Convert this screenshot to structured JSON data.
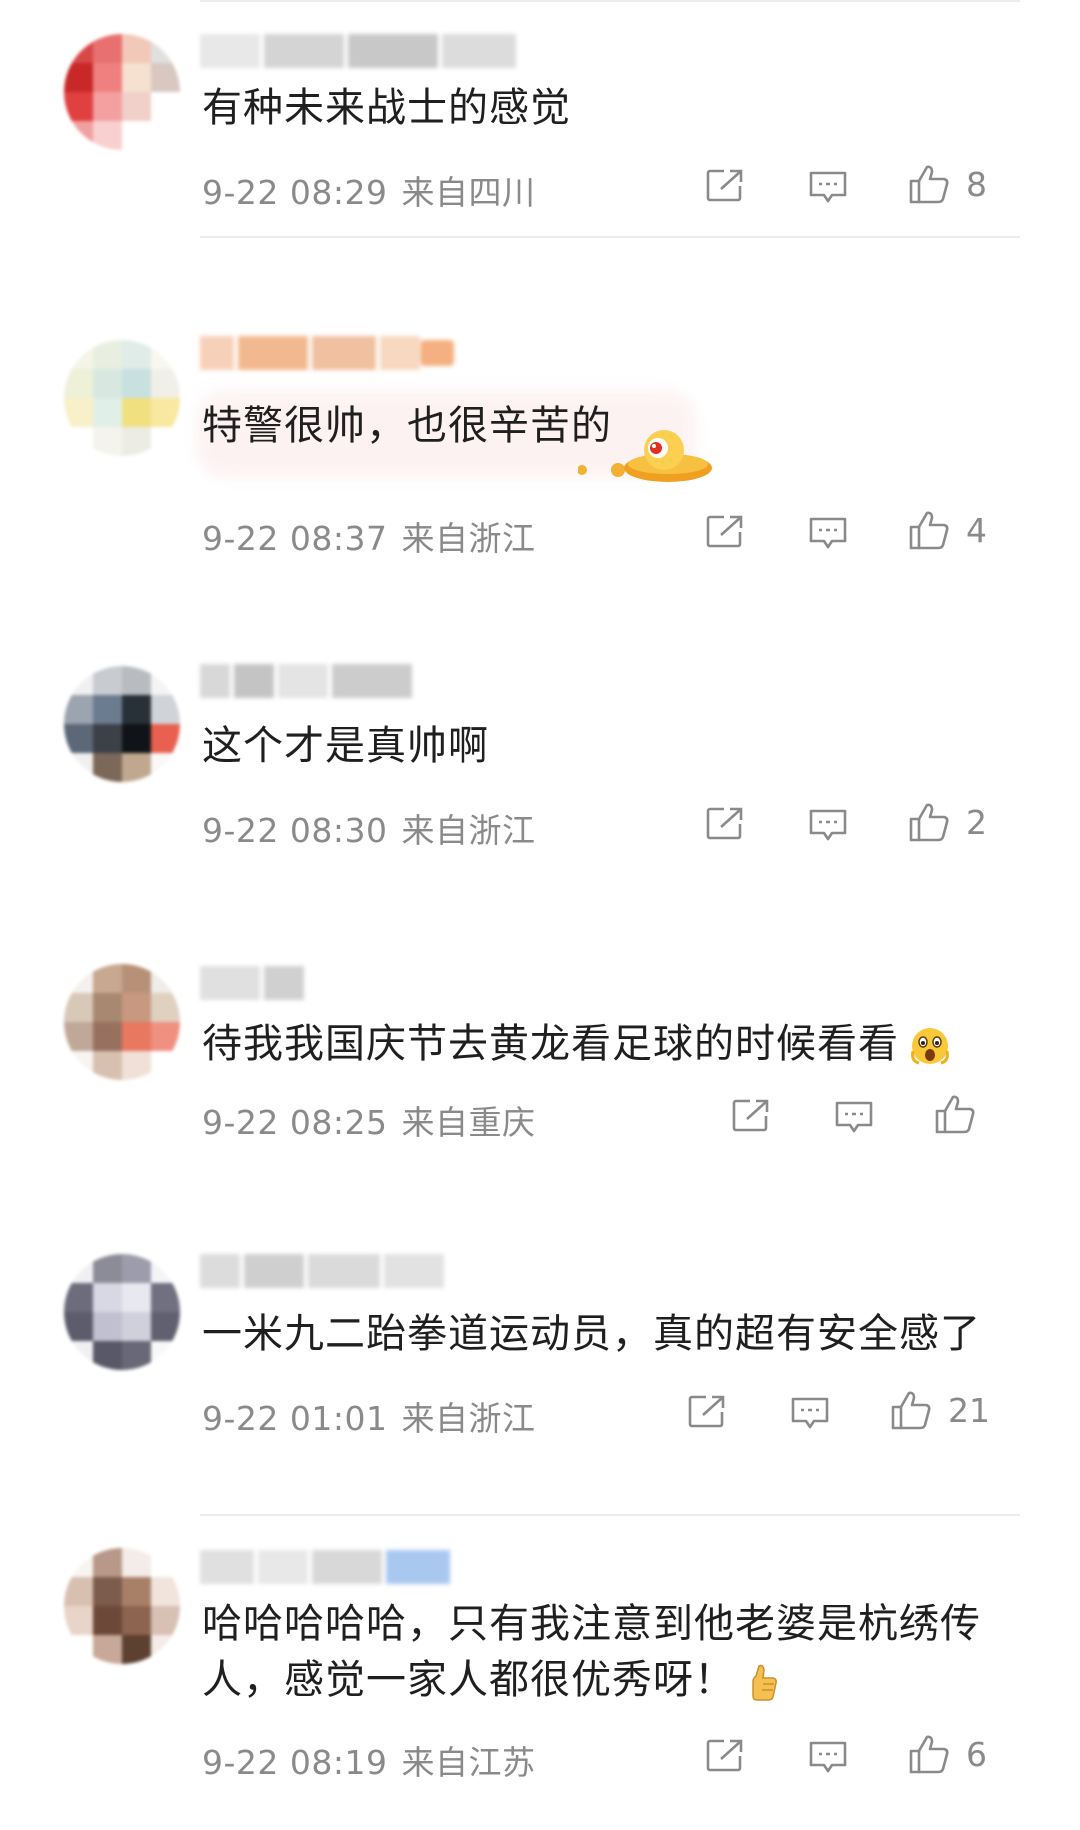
{
  "comments": [
    {
      "text": "有种未来战士的感觉",
      "time": "9-22 08:29",
      "location": "来自四川",
      "likes": "8"
    },
    {
      "text": "特警很帅，也很辛苦的",
      "time": "9-22 08:37",
      "location": "来自浙江",
      "likes": "4"
    },
    {
      "text": "这个才是真帅啊",
      "time": "9-22 08:30",
      "location": "来自浙江",
      "likes": "2"
    },
    {
      "text": "待我我国庆节去黄龙看足球的时候看看",
      "time": "9-22 08:25",
      "location": "来自重庆",
      "likes": ""
    },
    {
      "text": "一米九二跆拳道运动员，真的超有安全感了",
      "time": "9-22 01:01",
      "location": "来自浙江",
      "likes": "21"
    },
    {
      "text_line1": "哈哈哈哈哈，只有我注意到他老婆是杭绣传",
      "text_line2": "人，感觉一家人都很优秀呀！",
      "time": "9-22 08:19",
      "location": "来自江苏",
      "likes": "6"
    }
  ],
  "icons": {
    "share": "share-icon",
    "reply": "comment-icon",
    "like": "thumbs-up-icon",
    "emoji_ufo": "ufo-sticker-icon",
    "emoji_shock": "shocked-face-icon",
    "emoji_thumb": "thumbs-up-emoji-icon"
  },
  "colors": {
    "text": "#1f1f1f",
    "meta": "#8a8a8a",
    "icon": "#8a8a8a",
    "divider": "#ececec"
  }
}
